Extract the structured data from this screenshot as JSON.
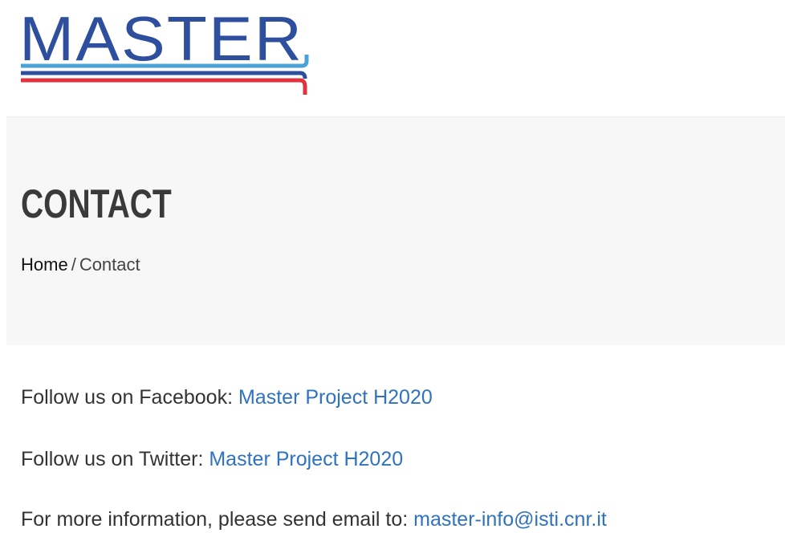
{
  "logo": {
    "text": "MASTER",
    "colors": {
      "text": "#2d4f9e",
      "stripe_light": "#4aa3d8",
      "stripe_dark": "#2d4f9e",
      "stripe_red": "#e1323d"
    }
  },
  "page": {
    "title": "CONTACT",
    "breadcrumb": {
      "home": "Home",
      "separator": "/",
      "current": "Contact"
    }
  },
  "contact": {
    "facebook": {
      "label": "Follow us on Facebook:",
      "link_text": "Master Project H2020"
    },
    "twitter": {
      "label": "Follow us on Twitter:",
      "link_text": "Master Project H2020"
    },
    "email": {
      "label": "For more information, please send email to:",
      "link_text": "master-info@isti.cnr.it"
    }
  },
  "colors": {
    "link": "#2f72bf",
    "band_background": "#f7f7f7",
    "title": "#3a3a3a"
  }
}
